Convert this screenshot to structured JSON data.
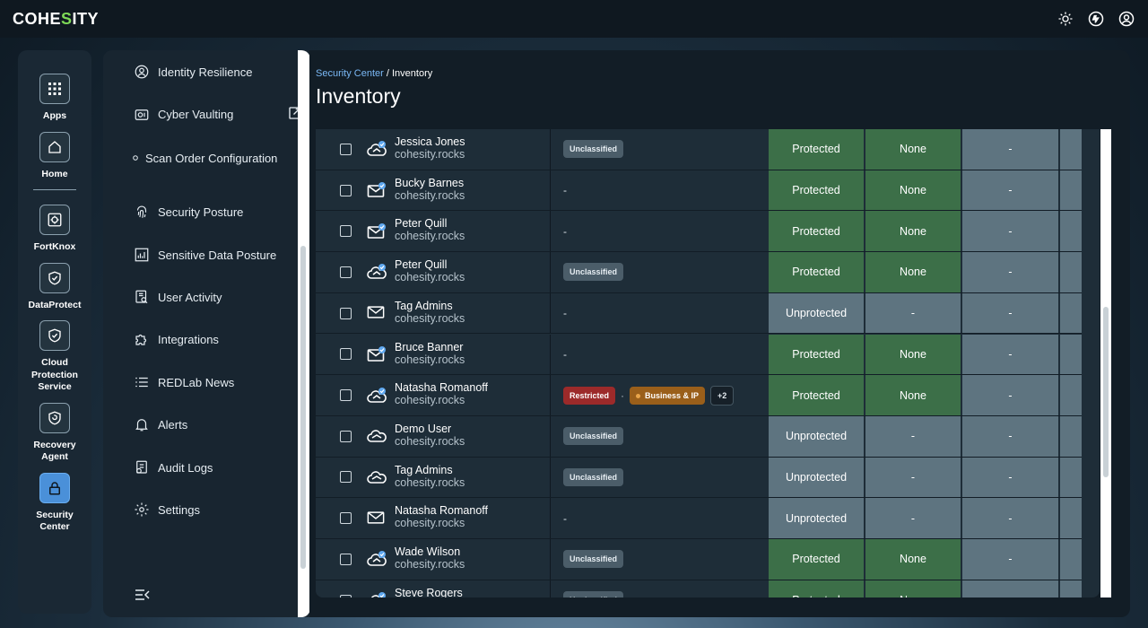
{
  "app": {
    "logo": "COHESITY"
  },
  "topbar": {
    "icons": [
      "sun-icon",
      "assistant-icon",
      "user-icon"
    ]
  },
  "rail": {
    "items": [
      {
        "label": "Apps",
        "icon": "grid-icon"
      },
      {
        "label": "Home",
        "icon": "home-icon"
      },
      {
        "label": "FortKnox",
        "icon": "vault-icon"
      },
      {
        "label": "DataProtect",
        "icon": "shield-icon"
      },
      {
        "label": "Cloud Protection Service",
        "icon": "shield-icon"
      },
      {
        "label": "Recovery Agent",
        "icon": "recovery-shield-icon"
      },
      {
        "label": "Security Center",
        "icon": "lock-icon",
        "active": true
      }
    ]
  },
  "sidebar": {
    "items": [
      {
        "label": "Identity Resilience",
        "icon": "identity-icon"
      },
      {
        "label": "Cyber Vaulting",
        "icon": "vault-icon",
        "external": true
      },
      {
        "label": "Scan Order Configuration",
        "icon": "dot-icon"
      },
      {
        "label": "Security Posture",
        "icon": "fingerprint-icon",
        "chevron": "›"
      },
      {
        "label": "Sensitive Data Posture",
        "icon": "chart-icon"
      },
      {
        "label": "User Activity",
        "icon": "user-activity-icon",
        "chevron": "›"
      },
      {
        "label": "Integrations",
        "icon": "puzzle-icon"
      },
      {
        "label": "REDLab News",
        "icon": "list-icon"
      },
      {
        "label": "Alerts",
        "icon": "bell-icon"
      },
      {
        "label": "Audit Logs",
        "icon": "audit-icon"
      },
      {
        "label": "Settings",
        "icon": "gear-icon",
        "chevron": "›"
      }
    ]
  },
  "breadcrumb": {
    "parent": "Security Center",
    "sep": " / ",
    "current": "Inventory"
  },
  "page": {
    "title": "Inventory"
  },
  "rows": [
    {
      "name": "Jessica Jones",
      "domain": "cohesity.rocks",
      "icon": "cloud-mail-icon",
      "cls": {
        "tags": [
          "Unclassified"
        ]
      },
      "status": "Protected",
      "risk": "None",
      "col5": "-"
    },
    {
      "name": "Bucky Barnes",
      "domain": "cohesity.rocks",
      "icon": "mail-check-icon",
      "cls": {
        "text": "-"
      },
      "status": "Protected",
      "risk": "None",
      "col5": "-"
    },
    {
      "name": "Peter Quill",
      "domain": "cohesity.rocks",
      "icon": "mail-check-icon",
      "cls": {
        "text": "-"
      },
      "status": "Protected",
      "risk": "None",
      "col5": "-"
    },
    {
      "name": "Peter Quill",
      "domain": "cohesity.rocks",
      "icon": "cloud-mail-icon",
      "cls": {
        "tags": [
          "Unclassified"
        ]
      },
      "status": "Protected",
      "risk": "None",
      "col5": "-"
    },
    {
      "name": "Tag Admins",
      "domain": "cohesity.rocks",
      "icon": "mail-icon",
      "cls": {
        "text": "-"
      },
      "status": "Unprotected",
      "risk": "-",
      "col5": "-"
    },
    {
      "name": "Bruce Banner",
      "domain": "cohesity.rocks",
      "icon": "mail-check-icon",
      "cls": {
        "text": "-"
      },
      "status": "Protected",
      "risk": "None",
      "col5": "-"
    },
    {
      "name": "Natasha Romanoff",
      "domain": "cohesity.rocks",
      "icon": "cloud-mail-icon",
      "cls": {
        "multi": {
          "restricted": "Restricted",
          "sep": "·",
          "category": "Business & IP",
          "more": "+2"
        }
      },
      "status": "Protected",
      "risk": "None",
      "col5": "-"
    },
    {
      "name": "Demo User",
      "domain": "cohesity.rocks",
      "icon": "cloud-icon",
      "cls": {
        "tags": [
          "Unclassified"
        ]
      },
      "status": "Unprotected",
      "risk": "-",
      "col5": "-"
    },
    {
      "name": "Tag Admins",
      "domain": "cohesity.rocks",
      "icon": "cloud-icon",
      "cls": {
        "tags": [
          "Unclassified"
        ]
      },
      "status": "Unprotected",
      "risk": "-",
      "col5": "-"
    },
    {
      "name": "Natasha Romanoff",
      "domain": "cohesity.rocks",
      "icon": "mail-icon",
      "cls": {
        "text": "-"
      },
      "status": "Unprotected",
      "risk": "-",
      "col5": "-"
    },
    {
      "name": "Wade Wilson",
      "domain": "cohesity.rocks",
      "icon": "cloud-mail-icon",
      "cls": {
        "tags": [
          "Unclassified"
        ]
      },
      "status": "Protected",
      "risk": "None",
      "col5": "-"
    },
    {
      "name": "Steve Rogers",
      "domain": "",
      "icon": "cloud-mail-icon",
      "cls": {
        "tags": [
          "Unclassified"
        ]
      },
      "status": "Protected",
      "risk": "None",
      "col5": ""
    }
  ]
}
